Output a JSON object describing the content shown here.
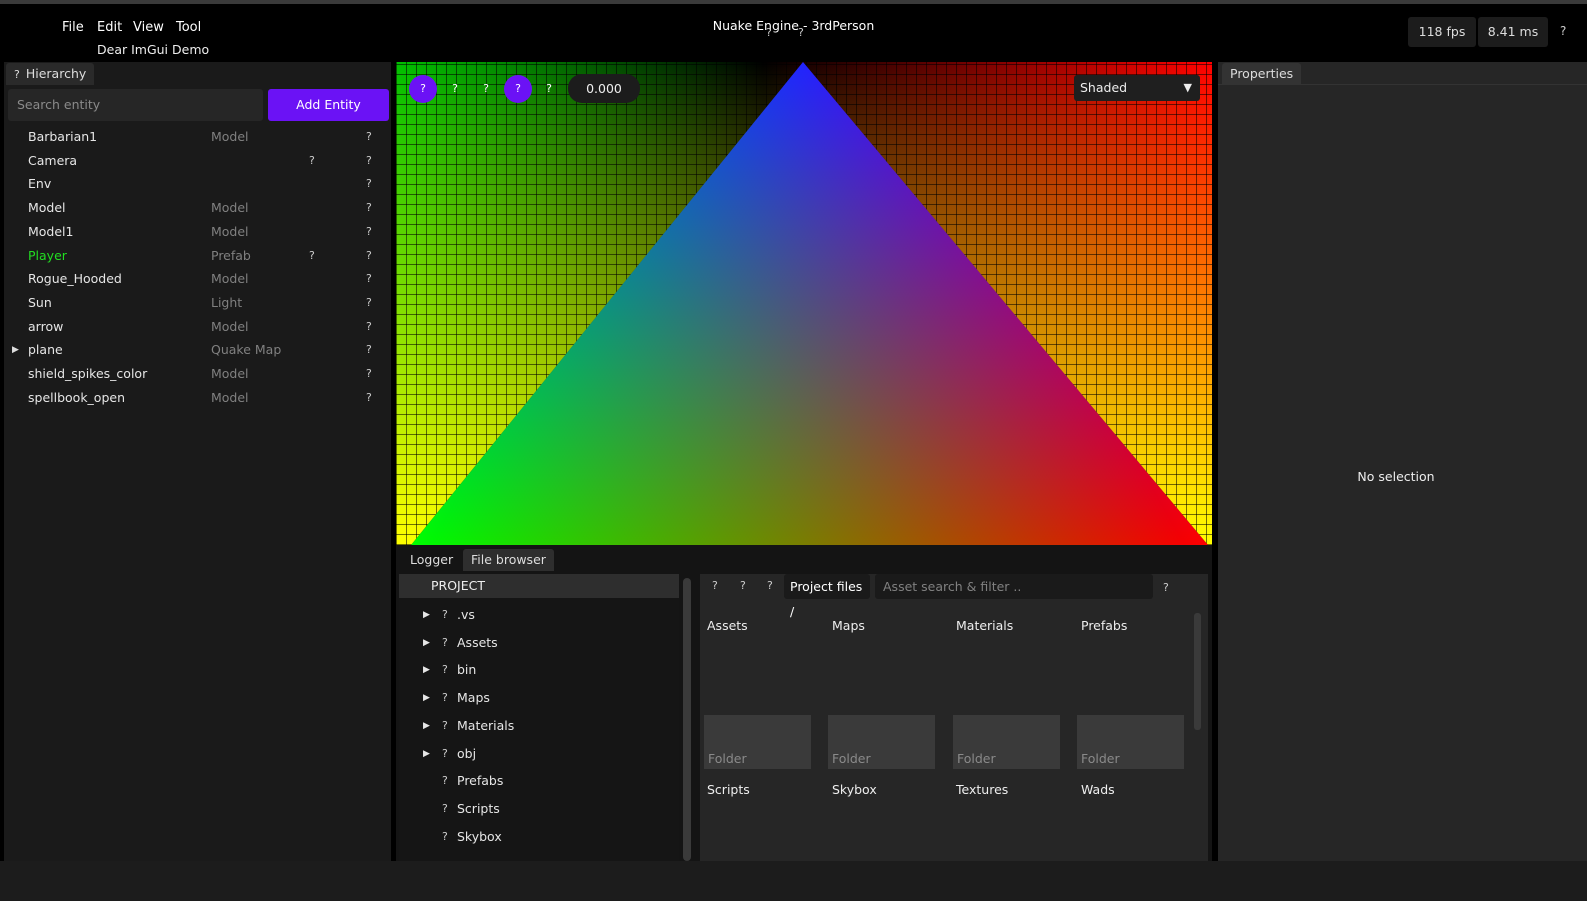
{
  "menu": {
    "items": [
      "File",
      "Edit",
      "View",
      "Tool"
    ],
    "sub_item": "Dear ImGui Demo",
    "title": "Nuake Engine - 3rdPerson",
    "fps": "118 fps",
    "ms": "8.41 ms",
    "help_glyph": "?"
  },
  "hierarchy": {
    "tab_icon": "?",
    "tab_label": "Hierarchy",
    "search_placeholder": "Search entity",
    "add_button": "Add Entity",
    "entities": [
      {
        "name": "Barbarian1",
        "type": "Model",
        "q1": "",
        "q2": "?"
      },
      {
        "name": "Camera",
        "type": "",
        "q1": "?",
        "q2": "?"
      },
      {
        "name": "Env",
        "type": "",
        "q1": "",
        "q2": "?"
      },
      {
        "name": "Model",
        "type": "Model",
        "q1": "",
        "q2": "?"
      },
      {
        "name": "Model1",
        "type": "Model",
        "q1": "",
        "q2": "?"
      },
      {
        "name": "Player",
        "type": "Prefab",
        "q1": "?",
        "q2": "?"
      },
      {
        "name": "Rogue_Hooded",
        "type": "Model",
        "q1": "",
        "q2": "?"
      },
      {
        "name": "Sun",
        "type": "Light",
        "q1": "",
        "q2": "?"
      },
      {
        "name": "arrow",
        "type": "Model",
        "q1": "",
        "q2": "?"
      },
      {
        "name": "plane",
        "type": "Quake Map",
        "q1": "",
        "q2": "?"
      },
      {
        "name": "shield_spikes_color",
        "type": "Model",
        "q1": "",
        "q2": "?"
      },
      {
        "name": "spellbook_open",
        "type": "Model",
        "q1": "",
        "q2": "?"
      }
    ],
    "highlight_color": "#22dd22"
  },
  "viewport": {
    "buttons": [
      "?",
      "?",
      "?",
      "?",
      "?"
    ],
    "value": "0.000",
    "render_mode": "Shaded",
    "caret": "▼"
  },
  "properties": {
    "tab_label": "Properties",
    "empty_text": "No selection"
  },
  "bottom": {
    "tabs": [
      "Logger",
      "File browser"
    ],
    "tree_header": "PROJECT",
    "tree_items": [
      {
        "label": ".vs",
        "expand": true
      },
      {
        "label": "Assets",
        "expand": true
      },
      {
        "label": "bin",
        "expand": true
      },
      {
        "label": "Maps",
        "expand": true
      },
      {
        "label": "Materials",
        "expand": true
      },
      {
        "label": "obj",
        "expand": true
      },
      {
        "label": "Prefabs",
        "expand": false
      },
      {
        "label": "Scripts",
        "expand": false
      },
      {
        "label": "Skybox",
        "expand": false
      }
    ],
    "tree_icon": "?",
    "toolbar_glyphs": [
      "?",
      "?",
      "?"
    ],
    "project_files": "Project files /",
    "asset_search_placeholder": "Asset search & filter ..",
    "search_help": "?",
    "folders_row1": [
      "Assets",
      "Maps",
      "Materials",
      "Prefabs"
    ],
    "folder_kind": "Folder",
    "folders_row2": [
      "Scripts",
      "Skybox",
      "Textures",
      "Wads"
    ]
  },
  "colors": {
    "accent": "#6b12f5"
  }
}
